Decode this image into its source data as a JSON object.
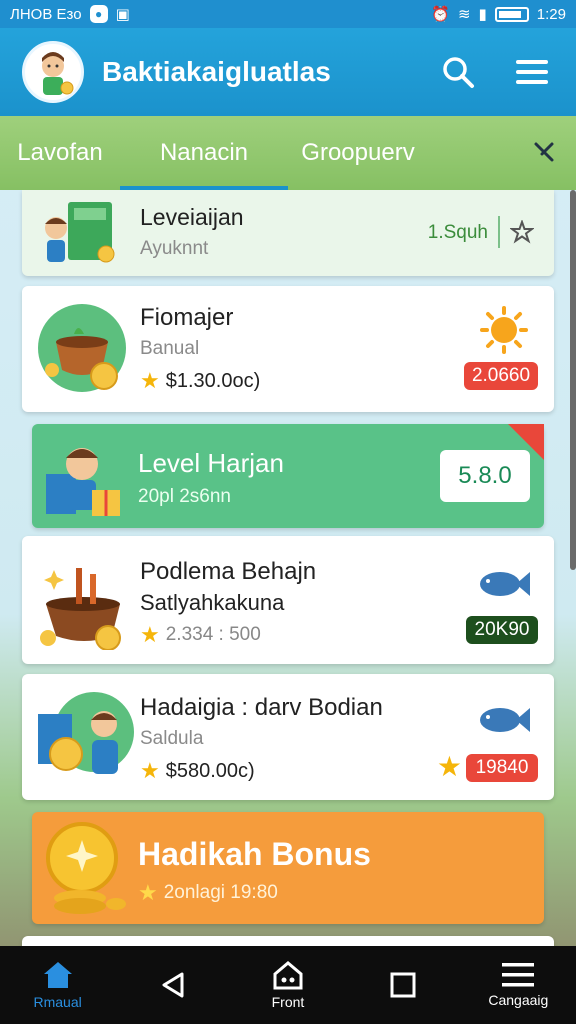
{
  "status_bar": {
    "carrier": "ЛНОВ Езо",
    "time": "1:29"
  },
  "app_bar": {
    "title": "Baktiakaigluatlas"
  },
  "tabs": [
    {
      "label": "Lavofan"
    },
    {
      "label": "Nanacin"
    },
    {
      "label": "Groopuerv"
    }
  ],
  "cards": [
    {
      "title": "Leveiaijan",
      "subtitle": "Ayuknnt",
      "badge": "1.Squh"
    },
    {
      "title": "Fiomajer",
      "subtitle": "Banual",
      "price": "$1.30.0oc)",
      "badge": "2.0660"
    },
    {
      "title": "Level Harjan",
      "subtitle": "20pl 2s6nn",
      "badge": "5.8.0"
    },
    {
      "title": "Podlema Behajn",
      "subtitle": "Satlyahkakuna",
      "price": "2.334 : 500",
      "badge": "20K90"
    },
    {
      "title": "Hadaigia : darv Bodian",
      "subtitle": "Saldula",
      "price": "$580.00c)",
      "badge": "19840"
    },
    {
      "title": "Hadikah Bonus",
      "subtitle": "2onlagi 19:80"
    }
  ],
  "nav": [
    {
      "label": "Rmaual",
      "icon": "home-icon"
    },
    {
      "label": "",
      "icon": "back-icon"
    },
    {
      "label": "Front",
      "icon": "house-outline-icon"
    },
    {
      "label": "",
      "icon": "recents-icon"
    },
    {
      "label": "Cangaaig",
      "icon": "menu-icon"
    }
  ],
  "colors": {
    "primary": "#1b92cc",
    "tab_green": "#86c063",
    "card_green": "#59c288",
    "bonus_orange": "#f59c3c",
    "badge_red": "#e9473a",
    "badge_dark_green": "#1d4f1d"
  }
}
